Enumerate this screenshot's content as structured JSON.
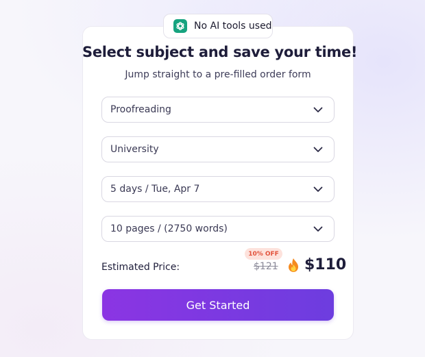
{
  "badge": {
    "icon": "openai-logo-icon",
    "text": "No AI tools used",
    "icon_color": "#16a37f"
  },
  "header": {
    "title": "Select subject and save your time!",
    "subtitle": "Jump straight to a pre-filled order form"
  },
  "form": {
    "selects": [
      {
        "name": "service",
        "value": "Proofreading"
      },
      {
        "name": "level",
        "value": "University"
      },
      {
        "name": "deadline",
        "value": "5 days / Tue, Apr 7"
      },
      {
        "name": "pages",
        "value": "10 pages / (2750 words)"
      }
    ]
  },
  "price": {
    "label": "Estimated Price:",
    "discount": "10% OFF",
    "old_price": "$121",
    "new_price": "$110",
    "icon": "fire-icon"
  },
  "cta": {
    "label": "Get Started",
    "colors": [
      "#8b35e3",
      "#6d3ddf"
    ]
  }
}
